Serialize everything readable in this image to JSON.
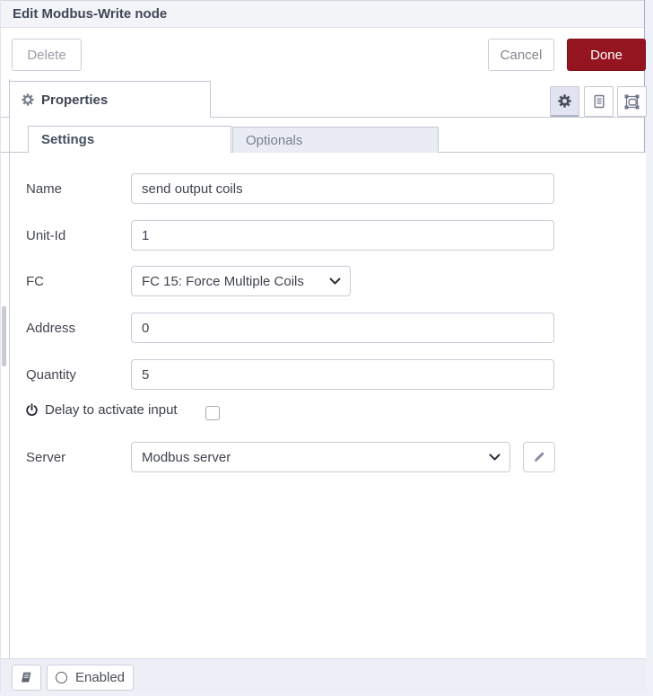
{
  "window": {
    "title": "Edit Modbus-Write node"
  },
  "toolbar": {
    "delete": "Delete",
    "cancel": "Cancel",
    "done": "Done"
  },
  "editor": {
    "properties_tab": "Properties",
    "icon_buttons": [
      "gear-icon",
      "description-icon",
      "appearance-icon"
    ],
    "active_icon": "gear-icon"
  },
  "tabs": {
    "settings": "Settings",
    "optionals": "Optionals"
  },
  "form": {
    "name": {
      "label": "Name",
      "value": "send output coils"
    },
    "unit_id": {
      "label": "Unit-Id",
      "value": "1"
    },
    "fc": {
      "label": "FC",
      "value": "FC 15: Force Multiple Coils"
    },
    "address": {
      "label": "Address",
      "value": "0"
    },
    "quantity": {
      "label": "Quantity",
      "value": "5"
    },
    "delay": {
      "label": "Delay to activate input",
      "checked": false
    },
    "server": {
      "label": "Server",
      "value": "Modbus server"
    }
  },
  "footer": {
    "enabled": "Enabled"
  },
  "icons": {
    "properties_tab": "gear-icon",
    "delay_row": "power-icon",
    "server_edit": "pencil-icon",
    "footer_left": "book-icon",
    "enabled": "circle-icon",
    "selects": "chevron-down-icon"
  },
  "colors": {
    "done_button_bg": "#94141F",
    "inactive_tab_bg": "#E9EBF5",
    "active_icon_button_bg": "#E2E5F1",
    "footer_bg": "#EDEFF7",
    "header_bg": "#F3F4F8"
  }
}
